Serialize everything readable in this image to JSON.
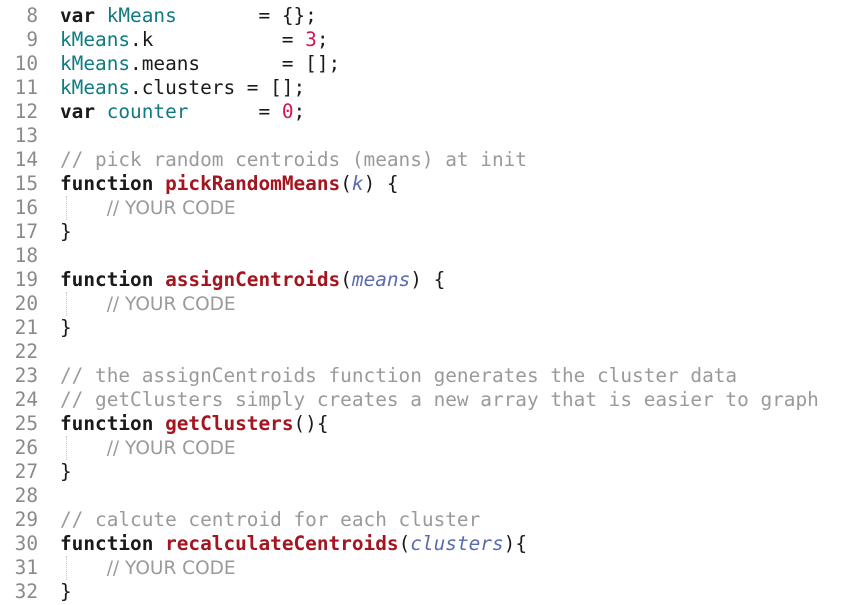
{
  "editor": {
    "lines": [
      {
        "n": "8",
        "tokens": [
          {
            "t": "kw",
            "v": "var "
          },
          {
            "t": "ident",
            "v": "kMeans"
          },
          {
            "t": "plain",
            "v": "       = {};"
          }
        ]
      },
      {
        "n": "9",
        "tokens": [
          {
            "t": "ident",
            "v": "kMeans"
          },
          {
            "t": "plain",
            "v": ".k           = "
          },
          {
            "t": "num",
            "v": "3"
          },
          {
            "t": "plain",
            "v": ";"
          }
        ]
      },
      {
        "n": "10",
        "tokens": [
          {
            "t": "ident",
            "v": "kMeans"
          },
          {
            "t": "plain",
            "v": ".means       = [];"
          }
        ]
      },
      {
        "n": "11",
        "tokens": [
          {
            "t": "ident",
            "v": "kMeans"
          },
          {
            "t": "plain",
            "v": ".clusters = [];"
          }
        ]
      },
      {
        "n": "12",
        "tokens": [
          {
            "t": "kw",
            "v": "var "
          },
          {
            "t": "ident",
            "v": "counter"
          },
          {
            "t": "plain",
            "v": "      = "
          },
          {
            "t": "num",
            "v": "0"
          },
          {
            "t": "plain",
            "v": ";"
          }
        ]
      },
      {
        "n": "13",
        "tokens": []
      },
      {
        "n": "14",
        "tokens": [
          {
            "t": "cm",
            "v": "// pick random centroids (means) at init"
          }
        ]
      },
      {
        "n": "15",
        "tokens": [
          {
            "t": "kw",
            "v": "function "
          },
          {
            "t": "fn",
            "v": "pickRandomMeans"
          },
          {
            "t": "plain",
            "v": "("
          },
          {
            "t": "param",
            "v": "k"
          },
          {
            "t": "plain",
            "v": ") {"
          }
        ]
      },
      {
        "n": "16",
        "guide": true,
        "tokens": [
          {
            "t": "plain",
            "v": "    "
          },
          {
            "t": "cm-sans",
            "v": "// YOUR CODE"
          }
        ]
      },
      {
        "n": "17",
        "tokens": [
          {
            "t": "plain",
            "v": "}"
          }
        ]
      },
      {
        "n": "18",
        "tokens": []
      },
      {
        "n": "19",
        "tokens": [
          {
            "t": "kw",
            "v": "function "
          },
          {
            "t": "fn",
            "v": "assignCentroids"
          },
          {
            "t": "plain",
            "v": "("
          },
          {
            "t": "param",
            "v": "means"
          },
          {
            "t": "plain",
            "v": ") {"
          }
        ]
      },
      {
        "n": "20",
        "guide": true,
        "tokens": [
          {
            "t": "plain",
            "v": "    "
          },
          {
            "t": "cm-sans",
            "v": "// YOUR CODE"
          }
        ]
      },
      {
        "n": "21",
        "tokens": [
          {
            "t": "plain",
            "v": "}"
          }
        ]
      },
      {
        "n": "22",
        "tokens": []
      },
      {
        "n": "23",
        "tokens": [
          {
            "t": "cm",
            "v": "// the assignCentroids function generates the cluster data"
          }
        ]
      },
      {
        "n": "24",
        "tokens": [
          {
            "t": "cm",
            "v": "// getClusters simply creates a new array that is easier to graph"
          }
        ]
      },
      {
        "n": "25",
        "tokens": [
          {
            "t": "kw",
            "v": "function "
          },
          {
            "t": "fn",
            "v": "getClusters"
          },
          {
            "t": "plain",
            "v": "(){"
          }
        ]
      },
      {
        "n": "26",
        "guide": true,
        "tokens": [
          {
            "t": "plain",
            "v": "    "
          },
          {
            "t": "cm-sans",
            "v": "// YOUR CODE"
          }
        ]
      },
      {
        "n": "27",
        "tokens": [
          {
            "t": "plain",
            "v": "}"
          }
        ]
      },
      {
        "n": "28",
        "tokens": []
      },
      {
        "n": "29",
        "tokens": [
          {
            "t": "cm",
            "v": "// calcute centroid for each cluster"
          }
        ]
      },
      {
        "n": "30",
        "tokens": [
          {
            "t": "kw",
            "v": "function "
          },
          {
            "t": "fn",
            "v": "recalculateCentroids"
          },
          {
            "t": "plain",
            "v": "("
          },
          {
            "t": "param",
            "v": "clusters"
          },
          {
            "t": "plain",
            "v": "){"
          }
        ]
      },
      {
        "n": "31",
        "guide": true,
        "tokens": [
          {
            "t": "plain",
            "v": "    "
          },
          {
            "t": "cm-sans",
            "v": "// YOUR CODE"
          }
        ]
      },
      {
        "n": "32",
        "tokens": [
          {
            "t": "plain",
            "v": "}"
          }
        ]
      }
    ],
    "colors": {
      "keyword": "#1a1a1a",
      "function_name": "#a3151f",
      "identifier": "#0f7a80",
      "number": "#d4145a",
      "parameter": "#5a6bb0",
      "comment": "#9a9a9a",
      "line_number": "#8a8a8a"
    }
  }
}
